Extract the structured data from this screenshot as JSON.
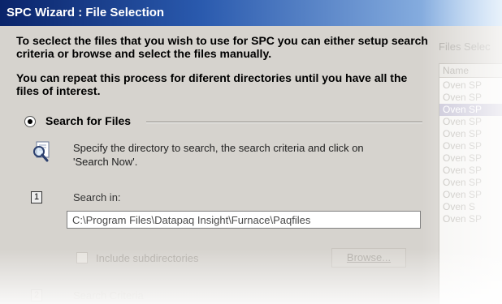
{
  "window": {
    "title": "SPC Wizard : File Selection"
  },
  "intro": {
    "line1": "To seclect the files that you wish to use for SPC you can either setup search criteria or browse and select the files manually.",
    "line2": "You can repeat this process for diferent directories until you have all the files of interest."
  },
  "search_section": {
    "radio_label": "Search for Files",
    "selected": true
  },
  "search_instruction": "Specify the directory to search, the search criteria and click on 'Search Now'.",
  "step1": {
    "number": "1",
    "label": "Search in:"
  },
  "search_path": {
    "value": "C:\\Program Files\\Datapaq Insight\\Furnace\\Paqfiles"
  },
  "include_subdirectories": {
    "label": "Include subdirectories",
    "checked": false
  },
  "browse_button": {
    "label": "Browse..."
  },
  "step2": {
    "number": "2",
    "label": "Search Criteria"
  },
  "files_panel": {
    "label": "Files Selec",
    "column_header": "Name",
    "items": [
      "Oven SP",
      "Oven SP",
      "Oven SP",
      "Oven SP",
      "Oven SP",
      "Oven SP",
      "Oven SP",
      "Oven SP",
      "Oven SP",
      "Oven SP",
      "Oven S",
      "Oven SP"
    ],
    "selected_index": 2
  },
  "colors": {
    "title_bar": "#0a246a",
    "window_bg": "#d6d3ce",
    "selection": "#c9c6d8"
  }
}
